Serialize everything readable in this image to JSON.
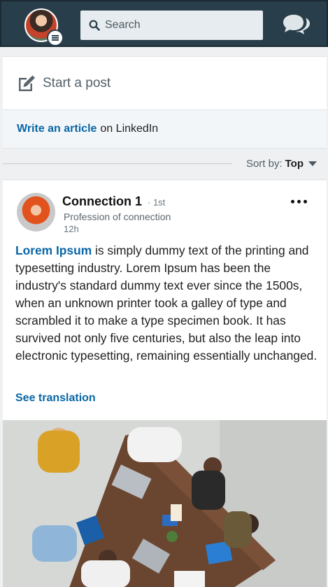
{
  "header": {
    "search_placeholder": "Search",
    "icons": [
      "profile-avatar",
      "menu-icon",
      "search-icon",
      "messaging-icon"
    ]
  },
  "share_box": {
    "start_post_label": "Start a post",
    "write_article_link": "Write an article",
    "write_article_suffix": "on LinkedIn"
  },
  "sort": {
    "label": "Sort by:",
    "value": "Top"
  },
  "post": {
    "author_name": "Connection 1",
    "degree": "· 1st",
    "headline": "Profession of connection",
    "time": "12h",
    "text_highlight": "Lorem Ipsum",
    "text_body": " is simply dummy text of the printing and typesetting industry. Lorem Ipsum has been the industry's standard dummy text ever since the 1500s, when an unknown printer took a galley of type and scrambled it to make a type specimen book. It has survived not only five centuries, but also the leap into electronic typesetting, remaining essentially unchanged.",
    "see_translation": "See translation"
  },
  "colors": {
    "topbar": "#283e4a",
    "link": "#0a66a6"
  }
}
